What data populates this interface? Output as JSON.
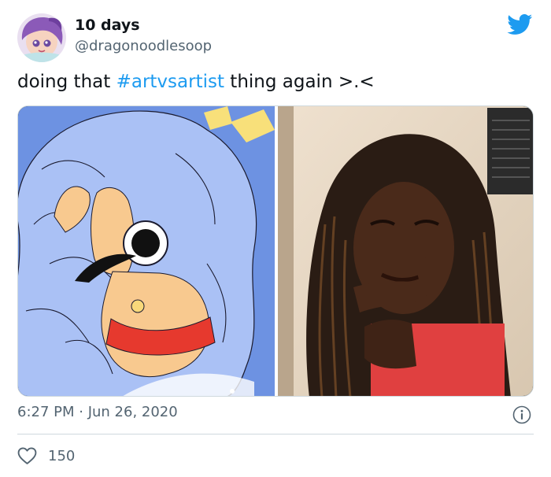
{
  "author": {
    "display_name": "10 days",
    "handle": "@dragonoodlesoop"
  },
  "tweet": {
    "text_before": "doing that ",
    "hashtag": "#artvsartist",
    "text_after": " thing again >.<"
  },
  "media": {
    "left": "drawing",
    "right": "photo"
  },
  "meta": {
    "timestamp": "6:27 PM · Jun 26, 2020"
  },
  "actions": {
    "like_count": "150"
  },
  "colors": {
    "accent": "#1d9bf0",
    "secondary_text": "#536471"
  },
  "icons": {
    "brand": "twitter-bird-icon",
    "info": "info-icon",
    "like": "heart-icon"
  }
}
